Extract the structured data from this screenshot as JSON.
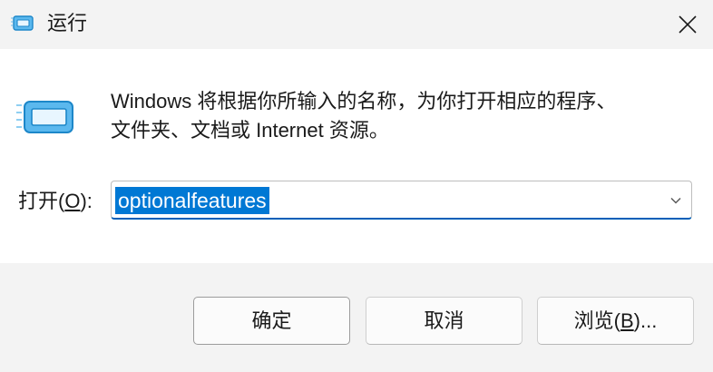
{
  "window": {
    "title": "运行",
    "title_icon": "run-app-icon",
    "close_icon": "close-icon"
  },
  "content": {
    "run_icon": "run-app-icon",
    "description_line1": "Windows 将根据你所输入的名称，为你打开相应的程序、",
    "description_line2": "文件夹、文档或 Internet 资源。",
    "open_label_prefix": "打开(",
    "open_label_mnemonic": "O",
    "open_label_suffix": "):",
    "open_value": "optionalfeatures",
    "dropdown_icon": "chevron-down-icon"
  },
  "buttons": {
    "ok_label": "确定",
    "cancel_label": "取消",
    "browse_prefix": "浏览(",
    "browse_mnemonic": "B",
    "browse_suffix": ")..."
  },
  "colors": {
    "accent": "#005fb8",
    "selection": "#0078d4",
    "titlebar_bg": "#f3f3f3",
    "footer_bg": "#f3f3f3"
  }
}
